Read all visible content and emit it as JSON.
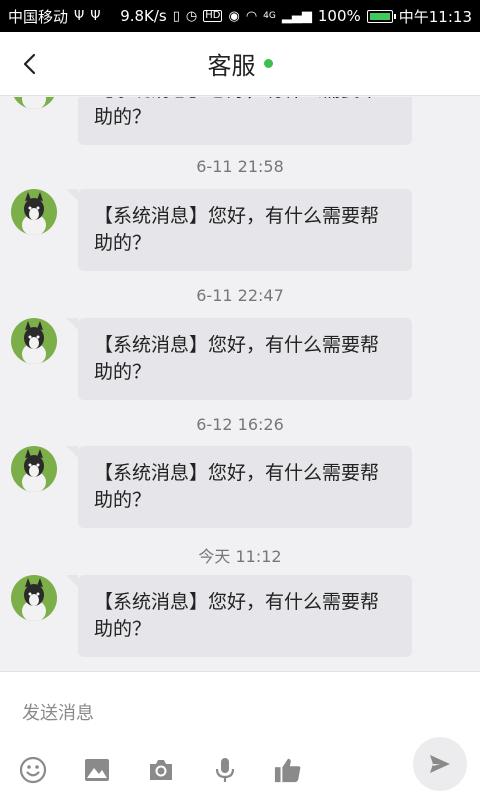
{
  "status_bar": {
    "carrier": "中国移动",
    "speed": "9.8K/s",
    "network": "4G",
    "battery": "100%",
    "time": "中午11:13",
    "icons": [
      "usb-icon",
      "usb-icon",
      "vibrate-icon",
      "alarm-icon",
      "hd-icon",
      "eye-icon",
      "wifi-icon",
      "signal-icon",
      "battery-icon"
    ]
  },
  "header": {
    "title": "客服",
    "status_color": "#3cc04c",
    "back_icon": "chevron-left-icon"
  },
  "messages": [
    {
      "timestamp": "",
      "text": "【系统消息】您好，有什么需要帮助的？"
    },
    {
      "timestamp": "6-11 21:58",
      "text": "【系统消息】您好，有什么需要帮助的？"
    },
    {
      "timestamp": "6-11 22:47",
      "text": "【系统消息】您好，有什么需要帮助的？"
    },
    {
      "timestamp": "6-12 16:26",
      "text": "【系统消息】您好，有什么需要帮助的？"
    },
    {
      "timestamp": "今天 11:12",
      "text": "【系统消息】您好，有什么需要帮助的？"
    }
  ],
  "composer": {
    "placeholder": "发送消息",
    "tools": [
      "emoji-icon",
      "image-icon",
      "camera-icon",
      "microphone-icon",
      "thumbs-up-icon"
    ],
    "send_icon": "send-icon"
  },
  "colors": {
    "bubble": "#e5e5ea",
    "background": "#f1f1f3",
    "icon": "#8a8a8a",
    "online": "#3cc04c"
  }
}
